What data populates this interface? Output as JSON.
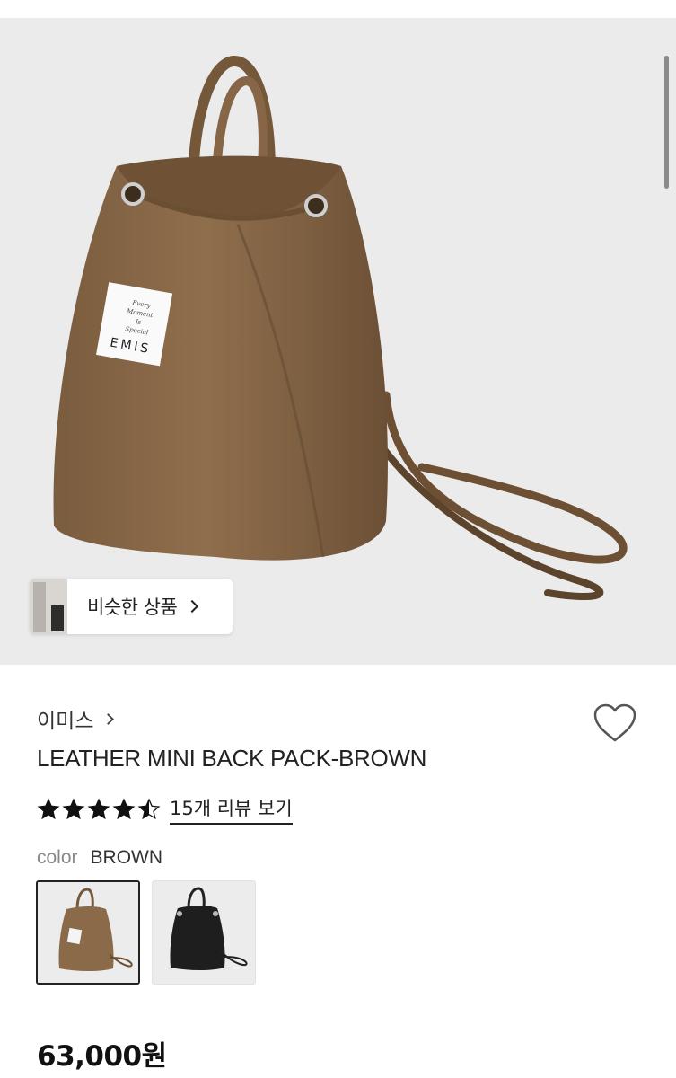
{
  "hero": {
    "label_lines": [
      "Every",
      "Moment",
      "Is",
      "Special"
    ],
    "label_brand": "EMIS",
    "similar_button_label": "비슷한 상품"
  },
  "product": {
    "brand": "이미스",
    "title": "LEATHER MINI BACK PACK-BROWN",
    "rating": 4.5,
    "rating_max": 5,
    "review_link": "15개 리뷰 보기",
    "color_label": "color",
    "color_value": "BROWN",
    "swatches": [
      {
        "name": "BROWN",
        "color": "#8a6a48",
        "selected": true
      },
      {
        "name": "BLACK",
        "color": "#1e1e1e",
        "selected": false
      }
    ],
    "price": "63,000원",
    "wishlisted": false
  },
  "colors": {
    "bag_brown": "#8a6a48",
    "bag_black": "#1e1e1e",
    "hero_bg": "#ebebeb"
  },
  "icons": {
    "wishlist": "heart-outline-icon",
    "chevron": "chevron-right-icon",
    "star": "star-icon"
  }
}
